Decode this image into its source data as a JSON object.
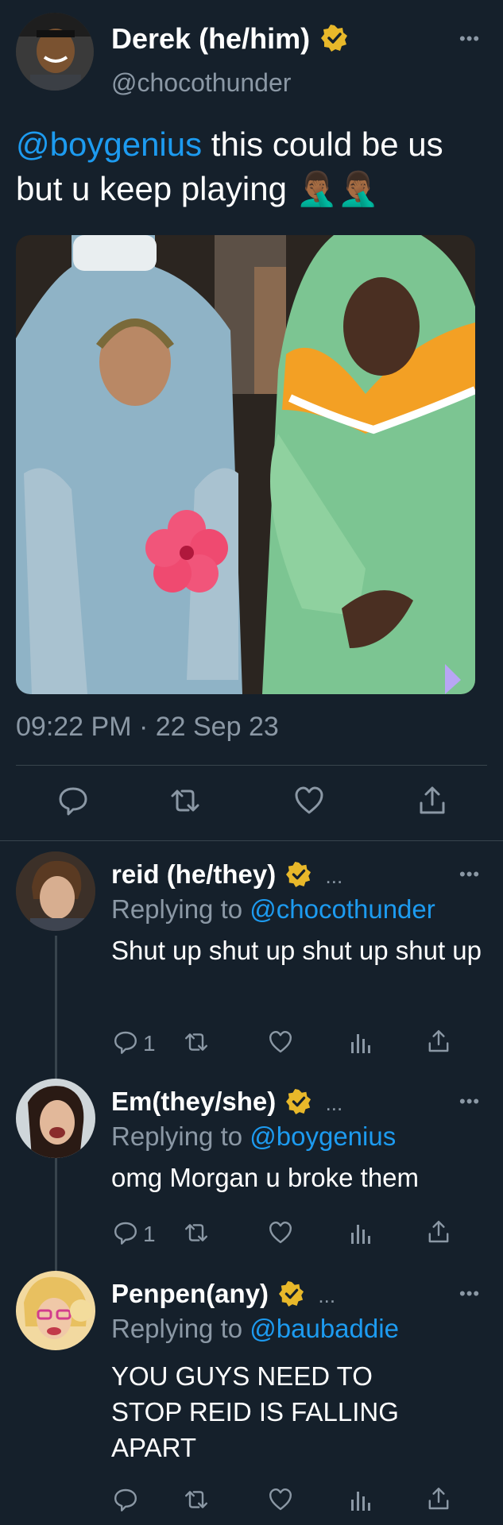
{
  "main_tweet": {
    "display_name": "Derek (he/him)",
    "handle": "@chocothunder",
    "mention": "@boygenius",
    "text": " this could be us but u keep playing 🤦🏾‍♂️🤦🏾‍♂️",
    "timestamp": "09:22 PM · 22 Sep 23",
    "more_icon": "more-dots-icon",
    "verified_icon": "verified-badge-icon"
  },
  "replies": [
    {
      "display_name": "reid (he/they)",
      "inline_dots": "...",
      "replying_prefix": "Replying to ",
      "replying_to": "@chocothunder",
      "text": "Shut up shut up shut up shut up",
      "reply_count": "1"
    },
    {
      "display_name": "Em(they/she)",
      "inline_dots": "...",
      "replying_prefix": "Replying to ",
      "replying_to": "@boygenius",
      "text": "omg Morgan u broke them",
      "reply_count": "1"
    },
    {
      "display_name": "Penpen(any)",
      "inline_dots": "...",
      "replying_prefix": "Replying to ",
      "replying_to": "@baubaddie",
      "text": "YOU GUYS NEED TO STOP REID IS FALLING APART",
      "reply_count": ""
    }
  ],
  "more_dots": "•••",
  "colors": {
    "background": "#15202b",
    "link": "#1d9bf0",
    "secondary_text": "#8b98a5",
    "divider": "#38444d",
    "verified_gold": "#e8b82a"
  }
}
